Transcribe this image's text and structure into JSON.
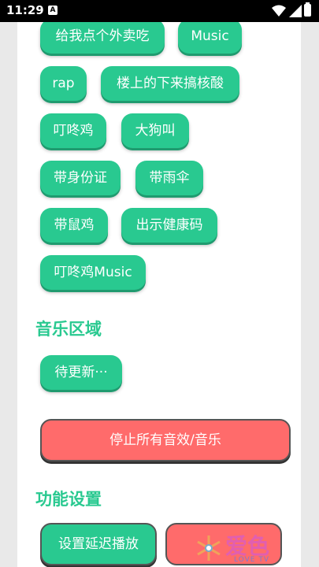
{
  "status_bar": {
    "time": "11:29",
    "notification_letter": "A"
  },
  "sound_buttons": [
    "给我点个外卖吃",
    "Music",
    "rap",
    "楼上的下来搞核酸",
    "叮咚鸡",
    "大狗叫",
    "带身份证",
    "带雨伞",
    "带鼠鸡",
    "出示健康码",
    "叮咚鸡Music"
  ],
  "music_section": {
    "title": "音乐区域",
    "placeholder_button": "待更新···"
  },
  "stop_button_label": "停止所有音效/音乐",
  "settings_section": {
    "title": "功能设置",
    "delay_button": "设置延迟播放"
  },
  "watermark": {
    "brand": "爱色",
    "sub": "LOVE TV"
  },
  "colors": {
    "accent_green": "#29c990",
    "stop_red": "#ff6b6b"
  }
}
